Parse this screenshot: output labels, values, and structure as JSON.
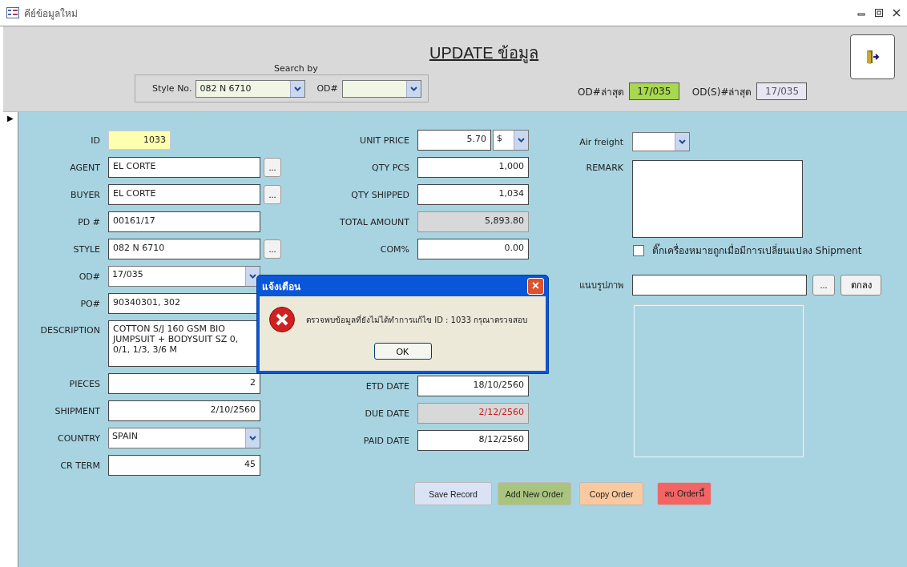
{
  "window": {
    "title": "คีย์ข้อมูลใหม่"
  },
  "header": {
    "title": "UPDATE ข้อมูล",
    "search": {
      "legend": "Search by",
      "style_label": "Style No.",
      "style_value": "082 N 6710",
      "od_label": "OD#"
    },
    "latest": [
      {
        "label": "OD#ล่าสุด",
        "value": "17/035",
        "kind": "highlight"
      },
      {
        "label": "OD(S)#ล่าสุด",
        "value": "17/035",
        "kind": "plain"
      }
    ]
  },
  "record_selector": "▶",
  "left_fields": [
    {
      "label": "ID",
      "value": "1033",
      "kind": "key"
    },
    {
      "label": "AGENT",
      "value": "EL CORTE",
      "kind": "text",
      "browse": "..."
    },
    {
      "label": "BUYER",
      "value": "EL CORTE",
      "kind": "text",
      "browse": "..."
    },
    {
      "label": "PD #",
      "value": "00161/17",
      "kind": "text"
    },
    {
      "label": "STYLE",
      "value": "082 N 6710",
      "kind": "text",
      "browse": "..."
    },
    {
      "label": "OD#",
      "value": "17/035",
      "kind": "combo"
    },
    {
      "label": "PO#",
      "value": "90340301, 302",
      "kind": "text"
    },
    {
      "label": "DESCRIPTION",
      "value": "COTTON S/J 160 GSM BIO JUMPSUIT + BODYSUIT SZ 0, 0/1, 1/3, 3/6 M",
      "kind": "memo"
    },
    {
      "label": "PIECES",
      "value": "2",
      "kind": "number"
    },
    {
      "label": "SHIPMENT",
      "value": "2/10/2560",
      "kind": "number"
    },
    {
      "label": "COUNTRY",
      "value": "SPAIN",
      "kind": "combo"
    },
    {
      "label": "CR TERM",
      "value": "45",
      "kind": "number"
    }
  ],
  "middle_top": [
    {
      "label": "UNIT PRICE",
      "value": "5.70",
      "kind": "currency",
      "currency": "$"
    },
    {
      "label": "QTY PCS",
      "value": "1,000",
      "kind": "number"
    },
    {
      "label": "QTY SHIPPED",
      "value": "1,034",
      "kind": "number"
    },
    {
      "label": "TOTAL AMOUNT",
      "value": "5,893.80",
      "kind": "readonly"
    },
    {
      "label": "COM%",
      "value": "0.00",
      "kind": "number"
    }
  ],
  "middle_bottom": [
    {
      "label": "ETD DATE",
      "value": "18/10/2560",
      "kind": "number"
    },
    {
      "label": "DUE DATE",
      "value": "2/12/2560",
      "kind": "overdue"
    },
    {
      "label": "PAID DATE",
      "value": "8/12/2560",
      "kind": "number"
    }
  ],
  "right": {
    "air_freight_label": "Air freight",
    "remark_label": "REMARK",
    "shipment_check": {
      "label": "ติ๊กเครื่องหมายถูกเมื่อมีการเปลี่ยนแปลง Shipment",
      "checked": false
    },
    "attach_label": "แนบรูปภาพ",
    "browse": "...",
    "ok": "ตกลง"
  },
  "buttons": [
    {
      "label": "Save Record",
      "color": "#d9e3f5"
    },
    {
      "label": "Add New Order",
      "color": "#a9c47f"
    },
    {
      "label": "Copy Order",
      "color": "#fbc9a0"
    },
    {
      "label": "ลบ Orderนี้",
      "color": "#f36464"
    }
  ],
  "dialog": {
    "title": "แจ้งเตือน",
    "close": "×",
    "message": "ตรวจพบข้อมูลที่ยังไม่ได้ทำการแก้ไข ID :  1033 กรุณาตรวจสอบ",
    "ok": "OK"
  }
}
